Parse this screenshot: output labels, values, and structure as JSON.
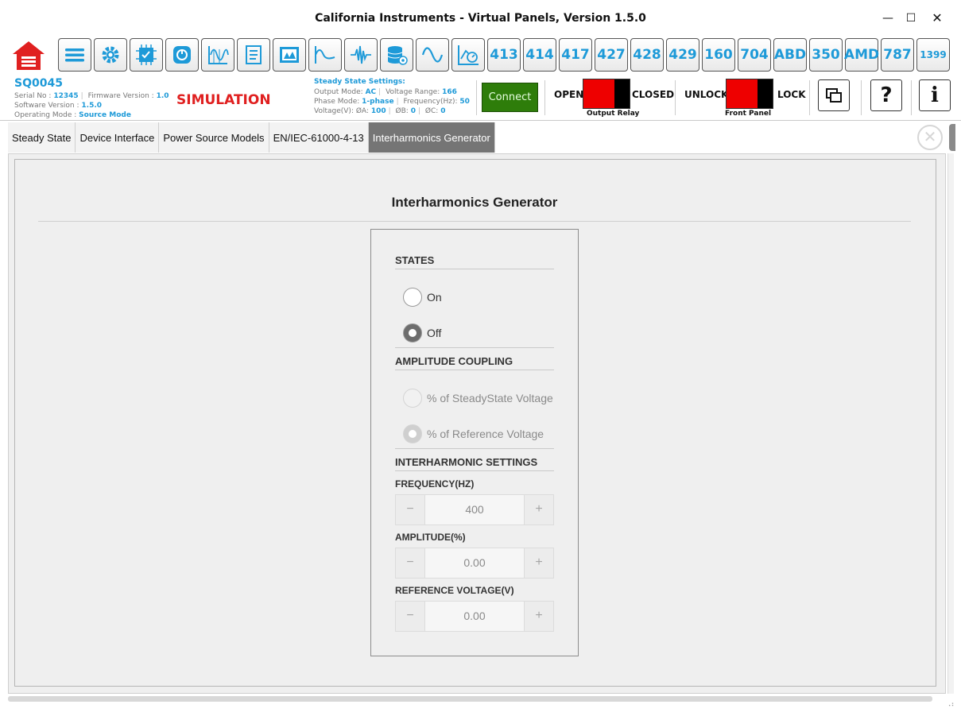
{
  "window": {
    "title": "California Instruments - Virtual Panels, Version 1.5.0",
    "min_glyph": "—",
    "max_glyph": "☐",
    "close_glyph": "✕"
  },
  "toolbar": {
    "icon_buttons": [
      "menu-icon",
      "gear-icon",
      "chip-icon",
      "power-icon",
      "waveform-chart-icon",
      "document-icon",
      "image-panel-icon",
      "wave-pulse-icon",
      "noise-icon",
      "database-icon",
      "sine-icon",
      "meter-icon"
    ],
    "model_buttons": [
      "413",
      "414",
      "417",
      "427",
      "428",
      "429",
      "160",
      "704",
      "ABD",
      "350",
      "AMD",
      "787",
      "1399"
    ]
  },
  "device": {
    "id": "SQ0045",
    "serial_label": "Serial No :",
    "serial": "12345",
    "firmware_label": "Firmware Version :",
    "firmware": "1.0",
    "software_label": "Software Version :",
    "software": "1.5.0",
    "mode_label": "Operating Mode :",
    "mode": "Source Mode",
    "simulation": "SIMULATION"
  },
  "steady_state": {
    "title": "Steady State Settings:",
    "output_mode_label": "Output Mode:",
    "output_mode": "AC",
    "voltage_range_label": "Voltage Range:",
    "voltage_range": "166",
    "phase_mode_label": "Phase Mode:",
    "phase_mode": "1-phase",
    "frequency_label": "Frequency(Hz):",
    "frequency": "50",
    "voltage_label": "Voltage(V): ØA:",
    "va": "100",
    "vb_label": "ØB:",
    "vb": "0",
    "vc_label": "ØC:",
    "vc": "0"
  },
  "connect_label": "Connect",
  "output_relay": {
    "left": "OPEN",
    "right": "CLOSED",
    "caption": "Output Relay",
    "state": "open"
  },
  "front_panel": {
    "left": "UNLOCK",
    "right": "LOCK",
    "caption": "Front Panel",
    "state": "unlock"
  },
  "side_buttons": {
    "help": "?",
    "info": "i"
  },
  "tabs": [
    {
      "label": "Steady State",
      "active": false
    },
    {
      "label": "Device Interface",
      "active": false
    },
    {
      "label": "Power Source Models",
      "active": false
    },
    {
      "label": "EN/IEC-61000-4-13",
      "active": false
    },
    {
      "label": "Interharmonics Generator",
      "active": true
    }
  ],
  "tab_close_glyph": "✕",
  "page": {
    "title": "Interharmonics Generator",
    "states": {
      "heading": "STATES",
      "options": [
        {
          "label": "On",
          "selected": false
        },
        {
          "label": "Off",
          "selected": true
        }
      ]
    },
    "coupling": {
      "heading": "AMPLITUDE COUPLING",
      "options": [
        {
          "label": "% of SteadyState Voltage",
          "selected": false
        },
        {
          "label": "% of Reference Voltage",
          "selected": true
        }
      ]
    },
    "settings": {
      "heading": "INTERHARMONIC SETTINGS",
      "frequency_label": "FREQUENCY(HZ)",
      "frequency": "400",
      "amplitude_label": "AMPLITUDE(%)",
      "amplitude": "0.00",
      "ref_label": "REFERENCE VOLTAGE(V)",
      "ref_voltage": "0.00",
      "minus": "−",
      "plus": "+"
    }
  },
  "colors": {
    "accent": "#1e9ad8",
    "simulation": "#e02020",
    "connect": "#2e7d0a",
    "toggle": "#ee0000",
    "active_tab": "#757575"
  }
}
